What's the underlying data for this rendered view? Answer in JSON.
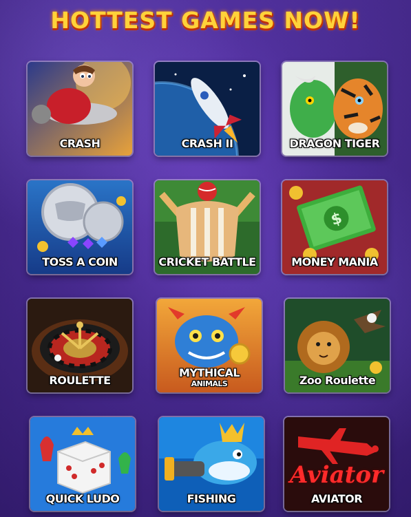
{
  "header": {
    "title": "HOTTEST GAMES NOW!"
  },
  "games": [
    {
      "label": "CRASH",
      "icon": "plane-pilot-icon"
    },
    {
      "label": "CRASH II",
      "icon": "rocket-icon"
    },
    {
      "label": "DRAGON TIGER",
      "icon": "dragon-tiger-icon"
    },
    {
      "label": "TOSS A COIN",
      "icon": "coin-icon"
    },
    {
      "label": "CRICKET BATTLE",
      "icon": "cricket-icon"
    },
    {
      "label": "MONEY MANIA",
      "icon": "money-stack-icon"
    },
    {
      "label": "ROULETTE",
      "icon": "roulette-wheel-icon"
    },
    {
      "label": "MYTHICAL",
      "sub": "ANIMALS",
      "icon": "dragon-icon"
    },
    {
      "label": "Zoo Roulette",
      "icon": "lion-eagle-icon"
    },
    {
      "label": "QUICK LUDO",
      "icon": "dice-icon"
    },
    {
      "label": "FISHING",
      "icon": "shark-icon"
    },
    {
      "label": "AVIATOR",
      "logo_text": "Aviator",
      "icon": "red-plane-icon"
    }
  ],
  "colors": {
    "title": "#ffd23a",
    "background": "#4b2a9a",
    "aviator_red": "#ff2b2b"
  }
}
